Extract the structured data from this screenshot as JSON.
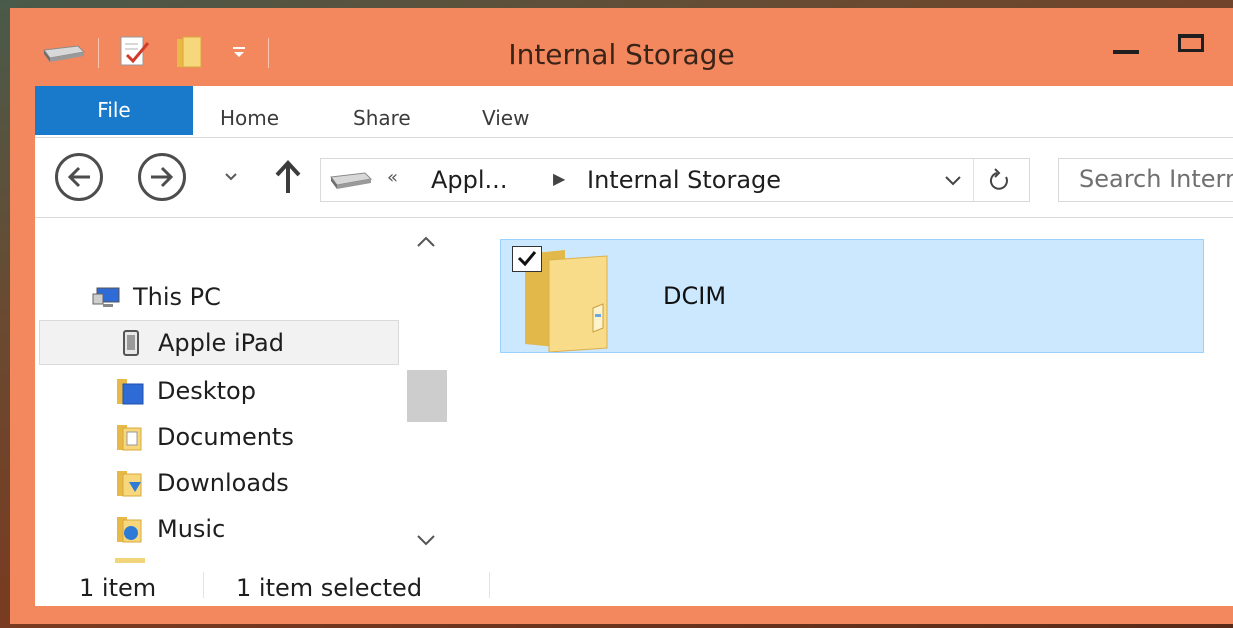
{
  "window": {
    "title": "Internal Storage",
    "accent_color": "#f3885f",
    "controls": {
      "minimize_icon": "minimize-icon",
      "maximize_icon": "maximize-icon"
    }
  },
  "quick_access_toolbar": {
    "icons": [
      "drive-icon",
      "properties-icon",
      "new-folder-icon",
      "customize-dropdown-icon"
    ]
  },
  "ribbon": {
    "tabs": [
      {
        "label": "File",
        "active": true,
        "color": "#1979ca"
      },
      {
        "label": "Home"
      },
      {
        "label": "Share"
      },
      {
        "label": "View"
      }
    ]
  },
  "navigation": {
    "back_icon": "back-arrow-icon",
    "forward_icon": "forward-arrow-icon",
    "recent_icon": "recent-locations-icon",
    "up_icon": "up-arrow-icon"
  },
  "address_bar": {
    "overflow_glyph": "«",
    "segments": [
      "Appl...",
      "Internal Storage"
    ],
    "separator_glyph": "▶"
  },
  "search": {
    "placeholder": "Search Internal Storage"
  },
  "nav_pane": {
    "items": [
      {
        "label": "This PC",
        "icon": "computer-icon"
      },
      {
        "label": "Apple iPad",
        "icon": "ipad-icon",
        "hovered": true
      },
      {
        "label": "Desktop",
        "icon": "desktop-folder-icon"
      },
      {
        "label": "Documents",
        "icon": "documents-folder-icon"
      },
      {
        "label": "Downloads",
        "icon": "downloads-folder-icon"
      },
      {
        "label": "Music",
        "icon": "music-folder-icon"
      }
    ]
  },
  "content": {
    "items": [
      {
        "name": "DCIM",
        "type": "folder",
        "selected": true,
        "checked": true
      }
    ],
    "selection_color": "#cce8ff"
  },
  "status_bar": {
    "item_count": "1 item",
    "selected_count": "1 item selected"
  }
}
